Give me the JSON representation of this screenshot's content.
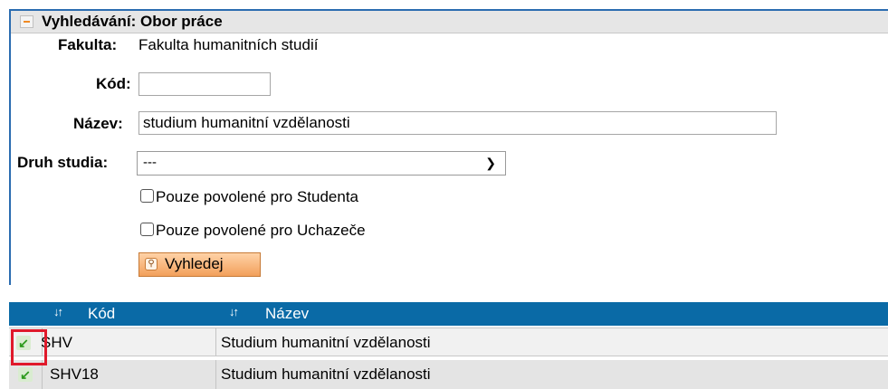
{
  "panel": {
    "title": "Vyhledávání: Obor práce",
    "collapse_icon": "minus-icon"
  },
  "form": {
    "faculty_label": "Fakulta:",
    "faculty_value": "Fakulta humanitních studií",
    "code_label": "Kód:",
    "code_value": "",
    "name_label": "Název:",
    "name_value": "studium humanitní vzdělanosti",
    "study_type_label": "Druh studia:",
    "study_type_value": "---",
    "student_only_label": "Pouze povolené pro Studenta",
    "applicant_only_label": "Pouze povolené pro Uchazeče",
    "search_button": "Vyhledej"
  },
  "table": {
    "columns": [
      "Kód",
      "Název"
    ],
    "sort_icon": "↓↑",
    "rows": [
      {
        "code": "SHV",
        "name": "Studium humanitní vzdělanosti"
      },
      {
        "code": "SHV18",
        "name": "Studium humanitní vzdělanosti"
      }
    ]
  },
  "colors": {
    "header_blue": "#0a6aa6",
    "button_orange": "#f2a05b",
    "highlight_red": "#e0192b",
    "select_icon_green": "#2b9a1a"
  }
}
